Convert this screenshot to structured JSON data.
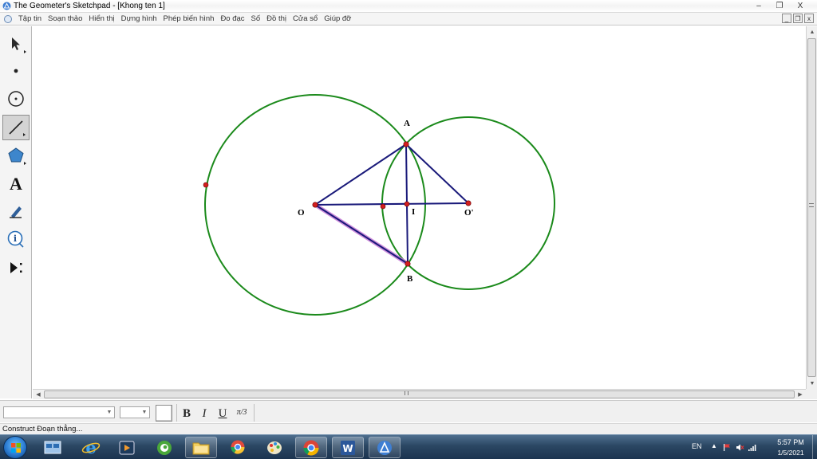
{
  "window": {
    "title": "The Geometer's Sketchpad - [Khong ten 1]",
    "controls": {
      "minimize": "–",
      "restore": "❐",
      "close": "X"
    }
  },
  "menubar": {
    "items": [
      "Tập tin",
      "Soạn thảo",
      "Hiển thị",
      "Dựng hình",
      "Phép biến hình",
      "Đo đạc",
      "Số",
      "Đồ thị",
      "Cửa sổ",
      "Giúp đỡ"
    ],
    "mdi": {
      "minimize": "_",
      "restore": "❐",
      "close": "x"
    }
  },
  "toolbox": {
    "tools": [
      {
        "name": "arrow-tool",
        "icon": "arrow-icon"
      },
      {
        "name": "point-tool",
        "icon": "point-icon"
      },
      {
        "name": "compass-tool",
        "icon": "compass-icon"
      },
      {
        "name": "straightedge-tool",
        "icon": "segment-icon",
        "active": true
      },
      {
        "name": "polygon-tool",
        "icon": "polygon-icon"
      },
      {
        "name": "text-tool",
        "icon": "text-icon",
        "glyph": "A"
      },
      {
        "name": "marker-tool",
        "icon": "marker-icon"
      },
      {
        "name": "information-tool",
        "icon": "info-icon",
        "glyph": "i"
      },
      {
        "name": "custom-tool",
        "icon": "custom-tool-icon"
      }
    ]
  },
  "sketch": {
    "labels": {
      "A": "A",
      "B": "B",
      "O": "O",
      "O_prime": "O'",
      "I": "I"
    },
    "colors": {
      "circle": "#1b8a1b",
      "segment": "#1a1a7a",
      "point": "#d21f1f",
      "highlight": "#b048c8"
    }
  },
  "formatbar": {
    "bold": "B",
    "italic": "I",
    "underline": "U",
    "math": "π/3"
  },
  "statusbar": {
    "text": "Construct Đoạn thẳng..."
  },
  "taskbar": {
    "apps": [
      "Start",
      "Windows Explorer",
      "Internet Explorer",
      "Media Player",
      "Coc Coc",
      "File Explorer",
      "Chrome Beta",
      "Paint",
      "Google Chrome",
      "Microsoft Word",
      "Sketchpad"
    ],
    "tray": {
      "lang": "EN",
      "time": "5:57 PM",
      "date": "1/5/2021"
    }
  }
}
